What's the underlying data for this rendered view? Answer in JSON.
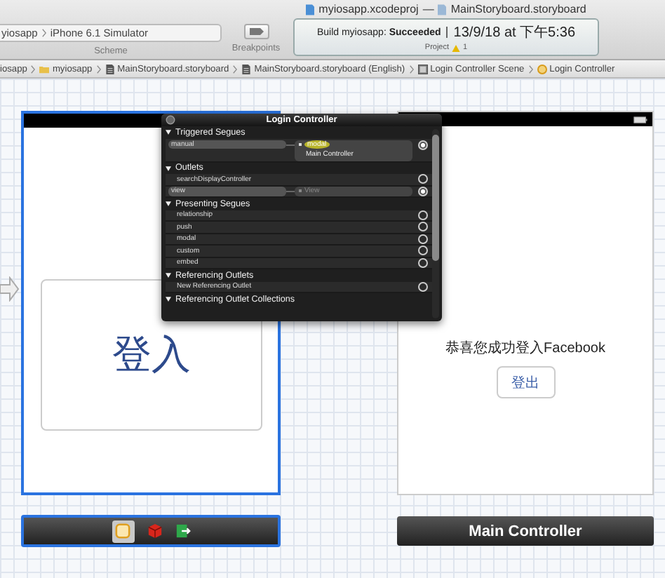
{
  "window_title": {
    "project": "myiosapp.xcodeproj",
    "separator": "—",
    "file": "MainStoryboard.storyboard"
  },
  "scheme": {
    "target": "yiosapp",
    "device": "iPhone 6.1 Simulator",
    "label": "Scheme"
  },
  "breakpoints": {
    "label": "Breakpoints"
  },
  "activity": {
    "status": "Build myiosapp: **Succeeded**",
    "time": "13/9/18 at 下午5:36",
    "project_label": "Project",
    "warnings": "1"
  },
  "breadcrumbs": [
    {
      "label": "iosapp",
      "kind": "none"
    },
    {
      "label": "myiosapp",
      "kind": "folder"
    },
    {
      "label": "MainStoryboard.storyboard",
      "kind": "file"
    },
    {
      "label": "MainStoryboard.storyboard (English)",
      "kind": "file"
    },
    {
      "label": "Login Controller Scene",
      "kind": "scene"
    },
    {
      "label": "Login Controller",
      "kind": "controller"
    }
  ],
  "popover": {
    "title": "Login Controller",
    "sections": [
      {
        "title": "Triggered Segues",
        "expanded": true,
        "rows": [
          {
            "name": "manual",
            "connected": true,
            "connection": {
              "kind": "segue",
              "label": "modal",
              "destination": "Main Controller"
            }
          }
        ]
      },
      {
        "title": "Outlets",
        "expanded": true,
        "rows": [
          {
            "name": "searchDisplayController",
            "connected": false
          },
          {
            "name": "view",
            "connected": true,
            "connection": {
              "kind": "outlet",
              "label": "View"
            }
          }
        ]
      },
      {
        "title": "Presenting Segues",
        "expanded": true,
        "rows": [
          {
            "name": "relationship",
            "connected": false
          },
          {
            "name": "push",
            "connected": false
          },
          {
            "name": "modal",
            "connected": false
          },
          {
            "name": "custom",
            "connected": false
          },
          {
            "name": "embed",
            "connected": false
          }
        ]
      },
      {
        "title": "Referencing Outlets",
        "expanded": true,
        "rows": [
          {
            "name": "New Referencing Outlet",
            "connected": false
          }
        ]
      },
      {
        "title": "Referencing Outlet Collections",
        "expanded": true
      }
    ]
  },
  "login_scene": {
    "selected": true,
    "button": "登入"
  },
  "main_scene": {
    "selected": false,
    "message": "恭喜您成功登入Facebook",
    "button": "登出",
    "dock_title": "Main Controller"
  }
}
